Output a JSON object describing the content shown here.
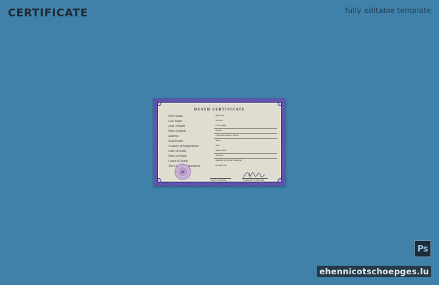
{
  "header": {
    "title": "CERTIFICATE",
    "tagline": "fully editable template"
  },
  "certificate": {
    "heading": "DEATH CERTIFICATE",
    "fields": [
      {
        "label": "First Name",
        "value": "Jake Lane"
      },
      {
        "label": "Last Name",
        "value": "Johnson"
      },
      {
        "label": "Date of Birth",
        "value": "12.05.1966"
      },
      {
        "label": "Place of Birth",
        "value": "Boston"
      },
      {
        "label": "Address",
        "value": "1200 Main Street, Boston"
      },
      {
        "label": "Sex/Gender",
        "value": "Male"
      },
      {
        "label": "Country of Registration",
        "value": "USA"
      },
      {
        "label": "Date of Death",
        "value": "08.07.2019"
      },
      {
        "label": "Place of Death",
        "value": "Medford"
      },
      {
        "label": "Cause of Death",
        "value": "BURDEN OF HEART DISEASE"
      },
      {
        "label": "The Certifier (Informant)",
        "value": "Dr. Paul Lee"
      }
    ],
    "signatures": {
      "left_caption": "COUNTY REGISTRAR",
      "right_caption": "SIGNATURE OF REGISTRAR"
    },
    "colors": {
      "border": "#5a4fae",
      "paper": "#dfdcd0",
      "seal": "#a27bb5"
    }
  },
  "badge": {
    "label": "Ps",
    "icon": "photoshop-icon"
  },
  "watermark": {
    "text": "ehennicotschoepges.lu"
  },
  "colors": {
    "background": "#3f81a9",
    "heading": "#202a33"
  }
}
